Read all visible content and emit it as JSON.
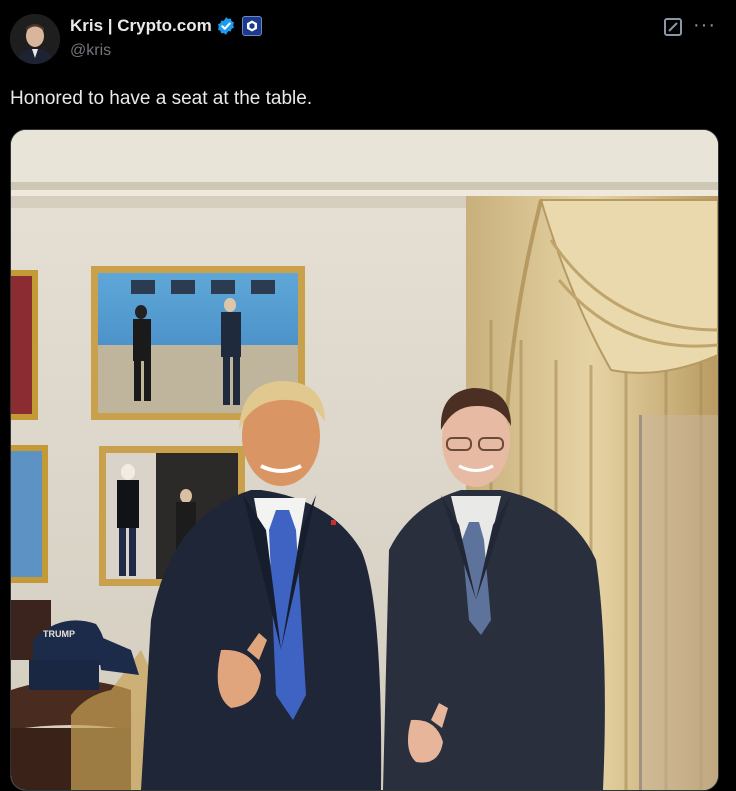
{
  "author": {
    "display_name": "Kris | Crypto.com",
    "handle": "@kris",
    "avatar_icon": "profile-photo",
    "verified_icon": "verified-badge-icon",
    "affiliation_icon": "crypto-com-affiliate-badge-icon"
  },
  "actions": {
    "grok_icon": "grok-icon",
    "more_icon": "more-options-icon",
    "more_glyph": "···"
  },
  "tweet": {
    "text": "Honored to have a seat at the table."
  },
  "media": {
    "hat_text": "TRUMP"
  },
  "colors": {
    "background": "#000000",
    "text": "#e7e9ea",
    "secondary_text": "#71767b",
    "verified": "#1d9bf0"
  }
}
